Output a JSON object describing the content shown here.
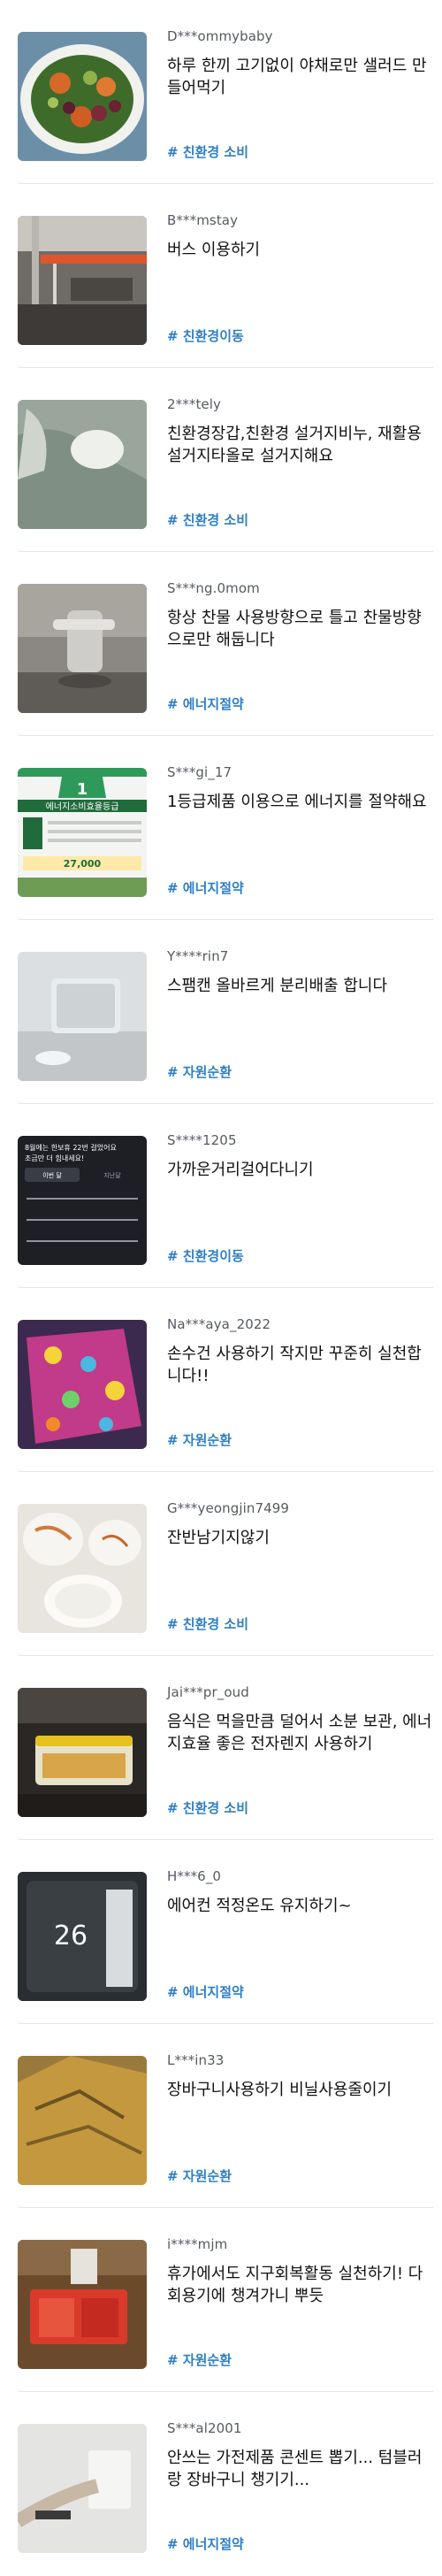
{
  "feed": {
    "items": [
      {
        "user": "D***ommybaby",
        "title": "하루 한끼 고기없이 야채로만 샐러드 만들어먹기",
        "tag": "# 친환경 소비",
        "thumb_icon": "salad-photo"
      },
      {
        "user": "B***mstay",
        "title": "버스 이용하기",
        "tag": "# 친환경이동",
        "thumb_icon": "bus-interior-photo"
      },
      {
        "user": "2***tely",
        "title": "친환경장갑,친환경 설거지비누, 재활용 설거지타올로 설거지해요",
        "tag": "# 친환경 소비",
        "thumb_icon": "dish-gloves-photo"
      },
      {
        "user": "S***ng.0mom",
        "title": "항상 찬물 사용방향으로 틀고 찬물방향으로만 해둡니다",
        "tag": "# 에너지절약",
        "thumb_icon": "faucet-photo"
      },
      {
        "user": "S***gi_17",
        "title": "1등급제품 이용으로 에너지를 절약해요",
        "tag": "# 에너지절약",
        "thumb_icon": "energy-label-photo"
      },
      {
        "user": "Y****rin7",
        "title": "스팸캔 올바르게 분리배출 합니다",
        "tag": "# 자원순환",
        "thumb_icon": "can-photo"
      },
      {
        "user": "S****1205",
        "title": "가까운거리걸어다니기",
        "tag": "# 친환경이동",
        "thumb_icon": "step-count-screenshot"
      },
      {
        "user": "Na***aya_2022",
        "title": "손수건 사용하기 작지만 꾸준히 실천합니다!!",
        "tag": "# 자원순환",
        "thumb_icon": "handkerchief-photo"
      },
      {
        "user": "G***yeongjin7499",
        "title": "잔반남기지않기",
        "tag": "# 친환경 소비",
        "thumb_icon": "empty-plates-photo"
      },
      {
        "user": "Jai***pr_oud",
        "title": "음식은 먹을만큼 덜어서 소분 보관, 에너지효율 좋은 전자렌지 사용하기",
        "tag": "# 친환경 소비",
        "thumb_icon": "food-container-photo"
      },
      {
        "user": "H***6_0",
        "title": "에어컨 적정온도 유지하기~",
        "tag": "# 에너지절약",
        "thumb_icon": "air-conditioner-photo"
      },
      {
        "user": "L***in33",
        "title": "장바구니사용하기 비닐사용줄이기",
        "tag": "# 자원순환",
        "thumb_icon": "shopping-bag-photo"
      },
      {
        "user": "i****mjm",
        "title": "휴가에서도 지구회복활동 실천하기! 다회용기에 챙겨가니 뿌듯",
        "tag": "# 자원순환",
        "thumb_icon": "reusable-container-photo"
      },
      {
        "user": "S***al2001",
        "title": "안쓰는 가전제품 콘센트 뽑기... 텀블러랑 장바구니 챙기기...",
        "tag": "# 에너지절약",
        "thumb_icon": "unplug-photo"
      }
    ]
  },
  "thumb_text": {
    "energy_label_number": "1",
    "energy_label_title": "에너지소비효율등급",
    "energy_label_value": "27,000",
    "step_title": "8월에는 한보휴 22번 걸었어요",
    "step_subtitle": "조금만 더 힘내세요!",
    "step_tab_1": "이번 달",
    "step_tab_2": "지난달",
    "ac_temp": "26"
  },
  "colors": {
    "tag": "#2f7fc1",
    "title": "#111111",
    "user": "#555a62",
    "divider": "#e6e6e6"
  }
}
